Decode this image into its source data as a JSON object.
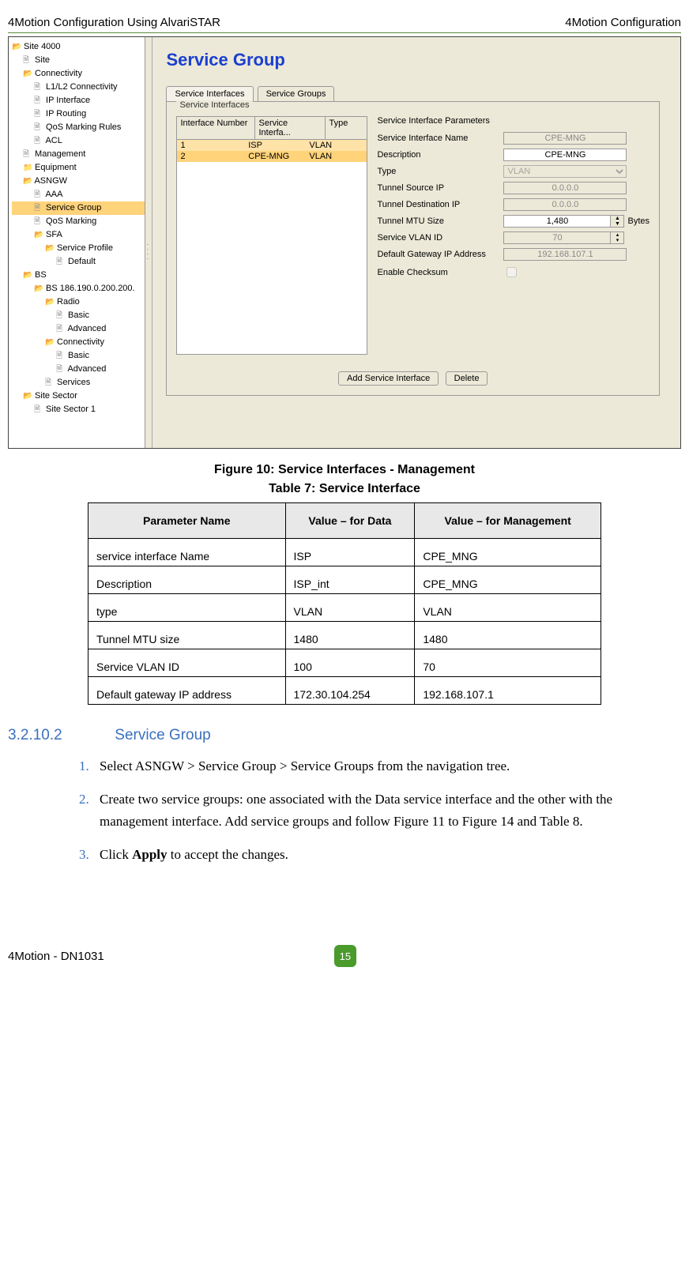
{
  "header": {
    "left": "4Motion Configuration Using AlvariSTAR",
    "right": "4Motion Configuration"
  },
  "screenshot": {
    "tree": [
      {
        "lvl": 0,
        "ic": "folder-open",
        "txt": "Site 4000"
      },
      {
        "lvl": 1,
        "ic": "file-ic",
        "txt": "Site"
      },
      {
        "lvl": 1,
        "ic": "folder-open",
        "txt": "Connectivity"
      },
      {
        "lvl": 2,
        "ic": "file-ic",
        "txt": "L1/L2 Connectivity"
      },
      {
        "lvl": 2,
        "ic": "file-ic",
        "txt": "IP Interface"
      },
      {
        "lvl": 2,
        "ic": "file-ic",
        "txt": "IP Routing"
      },
      {
        "lvl": 2,
        "ic": "file-ic",
        "txt": "QoS Marking Rules"
      },
      {
        "lvl": 2,
        "ic": "file-ic",
        "txt": "ACL"
      },
      {
        "lvl": 1,
        "ic": "file-ic",
        "txt": "Management"
      },
      {
        "lvl": 1,
        "ic": "folder-closed",
        "txt": "Equipment"
      },
      {
        "lvl": 1,
        "ic": "folder-open",
        "txt": "ASNGW"
      },
      {
        "lvl": 2,
        "ic": "file-ic",
        "txt": "AAA"
      },
      {
        "lvl": 2,
        "ic": "file-ic",
        "txt": "Service Group",
        "sel": true
      },
      {
        "lvl": 2,
        "ic": "file-ic",
        "txt": "QoS Marking"
      },
      {
        "lvl": 2,
        "ic": "folder-open",
        "txt": "SFA"
      },
      {
        "lvl": 3,
        "ic": "folder-open",
        "txt": "Service Profile"
      },
      {
        "lvl": 4,
        "ic": "file-ic",
        "txt": "Default"
      },
      {
        "lvl": 1,
        "ic": "folder-open",
        "txt": "BS"
      },
      {
        "lvl": 2,
        "ic": "folder-open",
        "txt": "BS 186.190.0.200.200."
      },
      {
        "lvl": 3,
        "ic": "folder-open",
        "txt": "Radio"
      },
      {
        "lvl": 4,
        "ic": "file-ic",
        "txt": "Basic"
      },
      {
        "lvl": 4,
        "ic": "file-ic",
        "txt": "Advanced"
      },
      {
        "lvl": 3,
        "ic": "folder-open",
        "txt": "Connectivity"
      },
      {
        "lvl": 4,
        "ic": "file-ic",
        "txt": "Basic"
      },
      {
        "lvl": 4,
        "ic": "file-ic",
        "txt": "Advanced"
      },
      {
        "lvl": 3,
        "ic": "file-ic",
        "txt": "Services"
      },
      {
        "lvl": 1,
        "ic": "folder-open",
        "txt": "Site Sector"
      },
      {
        "lvl": 2,
        "ic": "file-ic",
        "txt": "Site Sector 1"
      }
    ],
    "title": "Service Group",
    "tab1": "Service Interfaces",
    "tab2": "Service Groups",
    "fieldset": "Service Interfaces",
    "table": {
      "h1": "Interface Number",
      "h2": "Service Interfa...",
      "h3": "Type",
      "r1c1": "1",
      "r1c2": "ISP",
      "r1c3": "VLAN",
      "r2c1": "2",
      "r2c2": "CPE-MNG",
      "r2c3": "VLAN"
    },
    "paramsTitle": "Service Interface Parameters",
    "p": {
      "name_l": "Service Interface Name",
      "name_v": "CPE-MNG",
      "desc_l": "Description",
      "desc_v": "CPE-MNG",
      "type_l": "Type",
      "type_v": "VLAN",
      "tsip_l": "Tunnel Source IP",
      "tsip_v": "0.0.0.0",
      "tdip_l": "Tunnel Destination IP",
      "tdip_v": "0.0.0.0",
      "mtu_l": "Tunnel MTU Size",
      "mtu_v": "1,480",
      "mtu_u": "Bytes",
      "vlan_l": "Service VLAN ID",
      "vlan_v": "70",
      "gw_l": "Default Gateway IP Address",
      "gw_v": "192.168.107.1",
      "chk_l": "Enable Checksum"
    },
    "btn_add": "Add Service Interface",
    "btn_del": "Delete"
  },
  "figure_caption": "Figure 10: Service Interfaces - Management",
  "table_caption": "Table 7: Service Interface",
  "table7": {
    "h1": "Parameter Name",
    "h2": "Value – for Data",
    "h3": "Value – for Management",
    "rows": [
      {
        "a": "service interface Name",
        "b": "ISP",
        "c": "CPE_MNG"
      },
      {
        "a": "Description",
        "b": "ISP_int",
        "c": "CPE_MNG"
      },
      {
        "a": "type",
        "b": "VLAN",
        "c": "VLAN"
      },
      {
        "a": "Tunnel MTU size",
        "b": "1480",
        "c": "1480"
      },
      {
        "a": "Service VLAN ID",
        "b": "100",
        "c": "70"
      },
      {
        "a": "Default gateway IP address",
        "b": "172.30.104.254",
        "c": "192.168.107.1"
      }
    ]
  },
  "section": {
    "num": "3.2.10.2",
    "title": "Service Group"
  },
  "steps": {
    "s1": "Select ASNGW > Service Group > Service Groups from the navigation tree.",
    "s2": "Create two service groups: one associated with the Data service interface and the other with the management interface. Add service groups and follow Figure 11 to Figure 14 and Table 8.",
    "s3_a": "Click ",
    "s3_b": "Apply",
    "s3_c": " to accept the changes."
  },
  "footer": {
    "left": "4Motion - DN1031",
    "page": "15"
  }
}
